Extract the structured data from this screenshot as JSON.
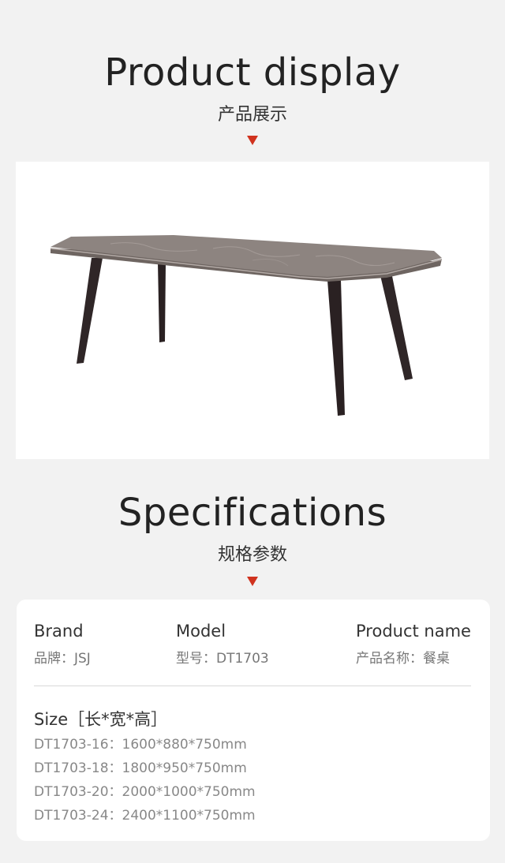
{
  "display_section": {
    "title_en": "Product display",
    "title_cn": "产品展示"
  },
  "product_image": {
    "alt": "table-photo"
  },
  "specs_section": {
    "title_en": "Specifications",
    "title_cn": "规格参数"
  },
  "specs": {
    "brand": {
      "label": "Brand",
      "value": "品牌：JSJ"
    },
    "model": {
      "label": "Model",
      "value": "型号：DT1703"
    },
    "product_name": {
      "label": "Product name",
      "value": "产品名称：餐桌"
    },
    "size": {
      "label": "Size［长*宽*高］",
      "rows": [
        "DT1703-16：1600*880*750mm",
        "DT1703-18：1800*950*750mm",
        "DT1703-20：2000*1000*750mm",
        "DT1703-24：2400*1100*750mm"
      ]
    }
  },
  "colors": {
    "accent": "#d0321e",
    "background": "#f2f2f2",
    "card": "#ffffff",
    "tabletop": "#8a807c",
    "legs": "#2e2526"
  }
}
